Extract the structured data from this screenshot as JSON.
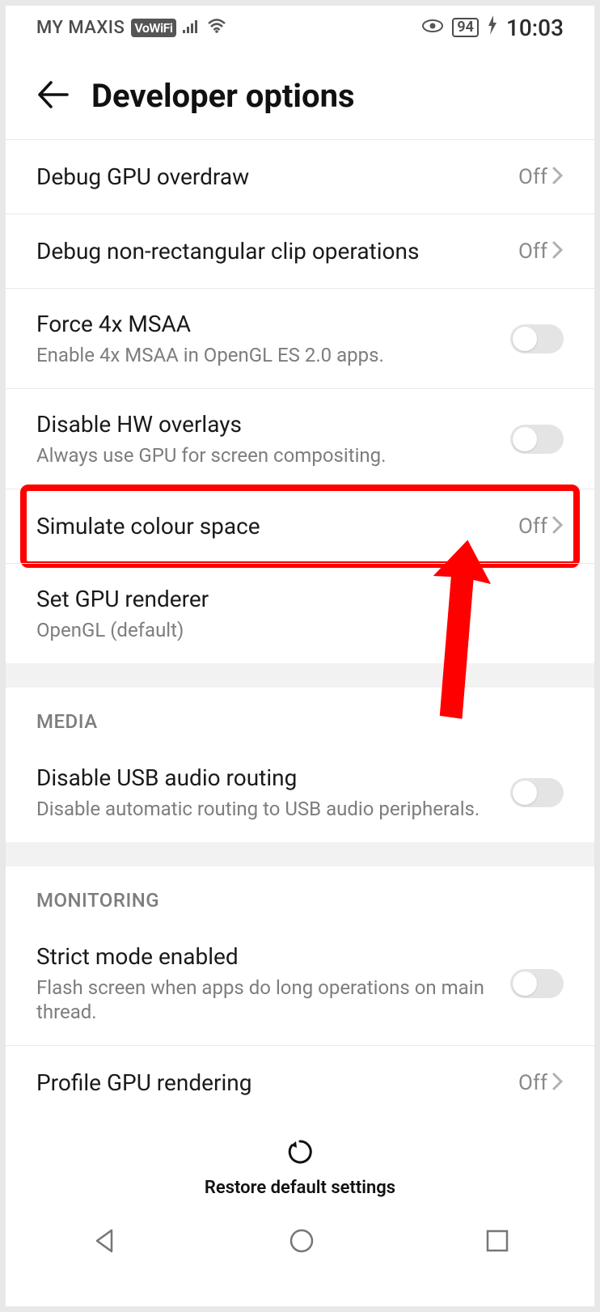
{
  "status": {
    "carrier": "MY MAXIS",
    "vowifi_label": "VoWiFi",
    "battery": "94",
    "clock": "10:03"
  },
  "header": {
    "title": "Developer options"
  },
  "rows": {
    "debug_overdraw": {
      "title": "Debug GPU overdraw",
      "value": "Off"
    },
    "debug_clip": {
      "title": "Debug non-rectangular clip operations",
      "value": "Off"
    },
    "msaa": {
      "title": "Force 4x MSAA",
      "subtitle": "Enable 4x MSAA in OpenGL ES 2.0 apps."
    },
    "hw_overlays": {
      "title": "Disable HW overlays",
      "subtitle": "Always use GPU for screen compositing."
    },
    "colour_space": {
      "title": "Simulate colour space",
      "value": "Off"
    },
    "gpu_renderer": {
      "title": "Set GPU renderer",
      "subtitle": "OpenGL (default)"
    },
    "usb_audio": {
      "title": "Disable USB audio routing",
      "subtitle": "Disable automatic routing to USB audio peripherals."
    },
    "strict_mode": {
      "title": "Strict mode enabled",
      "subtitle": "Flash screen when apps do long operations on main thread."
    },
    "profile_gpu": {
      "title": "Profile GPU rendering",
      "value": "Off"
    }
  },
  "sections": {
    "media": "MEDIA",
    "monitoring": "MONITORING"
  },
  "footer": {
    "restore_label": "Restore default settings"
  }
}
